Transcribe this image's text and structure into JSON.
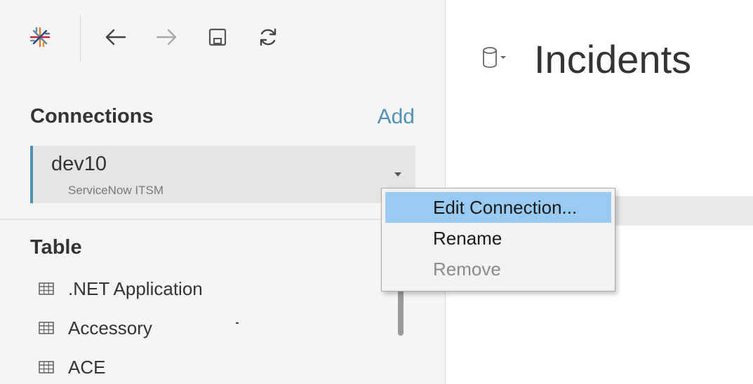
{
  "toolbar": {
    "logo_icon": "tableau-logo-icon",
    "back_icon": "arrow-left-icon",
    "forward_icon": "arrow-right-icon",
    "save_icon": "save-icon",
    "refresh_icon": "refresh-icon"
  },
  "connections": {
    "title": "Connections",
    "add_label": "Add",
    "items": [
      {
        "name": "dev10",
        "type": "ServiceNow ITSM"
      }
    ]
  },
  "tables": {
    "title": "Table",
    "items": [
      {
        "label": ".NET Application"
      },
      {
        "label": "Accessory"
      },
      {
        "label": "ACE"
      }
    ]
  },
  "datasource": {
    "title": "Incidents",
    "icon": "database-icon"
  },
  "context_menu": {
    "items": [
      {
        "label": "Edit Connection...",
        "state": "highlighted"
      },
      {
        "label": "Rename",
        "state": "normal"
      },
      {
        "label": "Remove",
        "state": "disabled"
      }
    ]
  },
  "colors": {
    "accent": "#4e93b6",
    "menu_highlight": "#99cbf2",
    "panel_bg": "#f5f5f5"
  }
}
